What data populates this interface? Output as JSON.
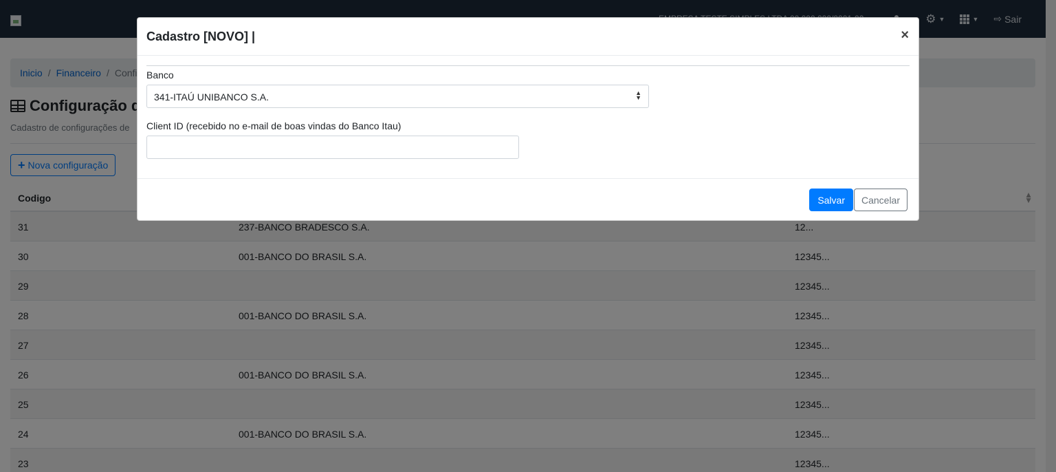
{
  "navbar": {
    "company": "EMPRESA TESTE SIMPLES LTDA 00.000.000/0001-00",
    "logout_label": "Sair"
  },
  "breadcrumb": [
    "Inicio",
    "Financeiro",
    "Confi"
  ],
  "page": {
    "title": "Configuração de",
    "subtitle": "Cadastro de configurações de",
    "new_button": "Nova configuração"
  },
  "table": {
    "header_code": "Codigo",
    "rows": [
      {
        "code": "31",
        "bank": "237-BANCO BRADESCO S.A.",
        "client": "12..."
      },
      {
        "code": "30",
        "bank": "001-BANCO DO BRASIL S.A.",
        "client": "12345..."
      },
      {
        "code": "29",
        "bank": "",
        "client": "12345..."
      },
      {
        "code": "28",
        "bank": "001-BANCO DO BRASIL S.A.",
        "client": "12345..."
      },
      {
        "code": "27",
        "bank": "",
        "client": "12345..."
      },
      {
        "code": "26",
        "bank": "001-BANCO DO BRASIL S.A.",
        "client": "12345..."
      },
      {
        "code": "25",
        "bank": "",
        "client": "12345..."
      },
      {
        "code": "24",
        "bank": "001-BANCO DO BRASIL S.A.",
        "client": "12345..."
      },
      {
        "code": "23",
        "bank": "",
        "client": "12345..."
      }
    ]
  },
  "modal": {
    "title": "Cadastro [NOVO] |",
    "close_symbol": "×",
    "banco_label": "Banco",
    "banco_selected": "341-ITAÚ UNIBANCO S.A.",
    "client_label": "Client ID (recebido no e-mail de boas vindas do Banco Itau)",
    "client_value": "",
    "save_label": "Salvar",
    "cancel_label": "Cancelar"
  },
  "colors": {
    "navbar": "#1c2a3a",
    "primary": "#007bff",
    "backdrop": "rgba(0,0,0,0.5)"
  },
  "icons": [
    "table-icon",
    "user-icon",
    "gear-icon",
    "grid-icon",
    "sign-out-icon",
    "plus-icon",
    "sort-icon",
    "close-icon",
    "select-arrows-icon"
  ]
}
